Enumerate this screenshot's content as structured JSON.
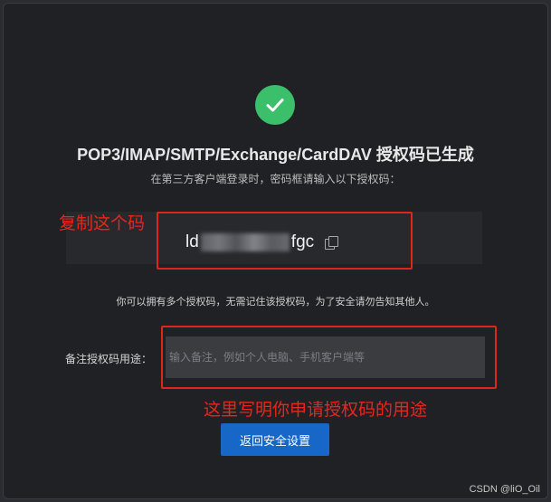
{
  "dialog": {
    "title": "POP3/IMAP/SMTP/Exchange/CardDAV 授权码已生成",
    "subtitle": "在第三方客户端登录时，密码框请输入以下授权码：",
    "code_visible_start": "ld",
    "code_visible_end": "fgc",
    "notice": "你可以拥有多个授权码，无需记住该授权码，为了安全请勿告知其他人。",
    "note_label": "备注授权码用途：",
    "note_placeholder": "输入备注，例如个人电脑、手机客户端等",
    "note_value": "",
    "back_button_label": "返回安全设置"
  },
  "annotations": {
    "copy_hint": "复制这个码",
    "purpose_hint": "这里写明你申请授权码的用途",
    "color": "#e0251b"
  },
  "watermark": "CSDN @liO_Oil",
  "colors": {
    "success_green": "#3cbf6b",
    "primary_blue": "#1767c9",
    "background": "#202124"
  }
}
